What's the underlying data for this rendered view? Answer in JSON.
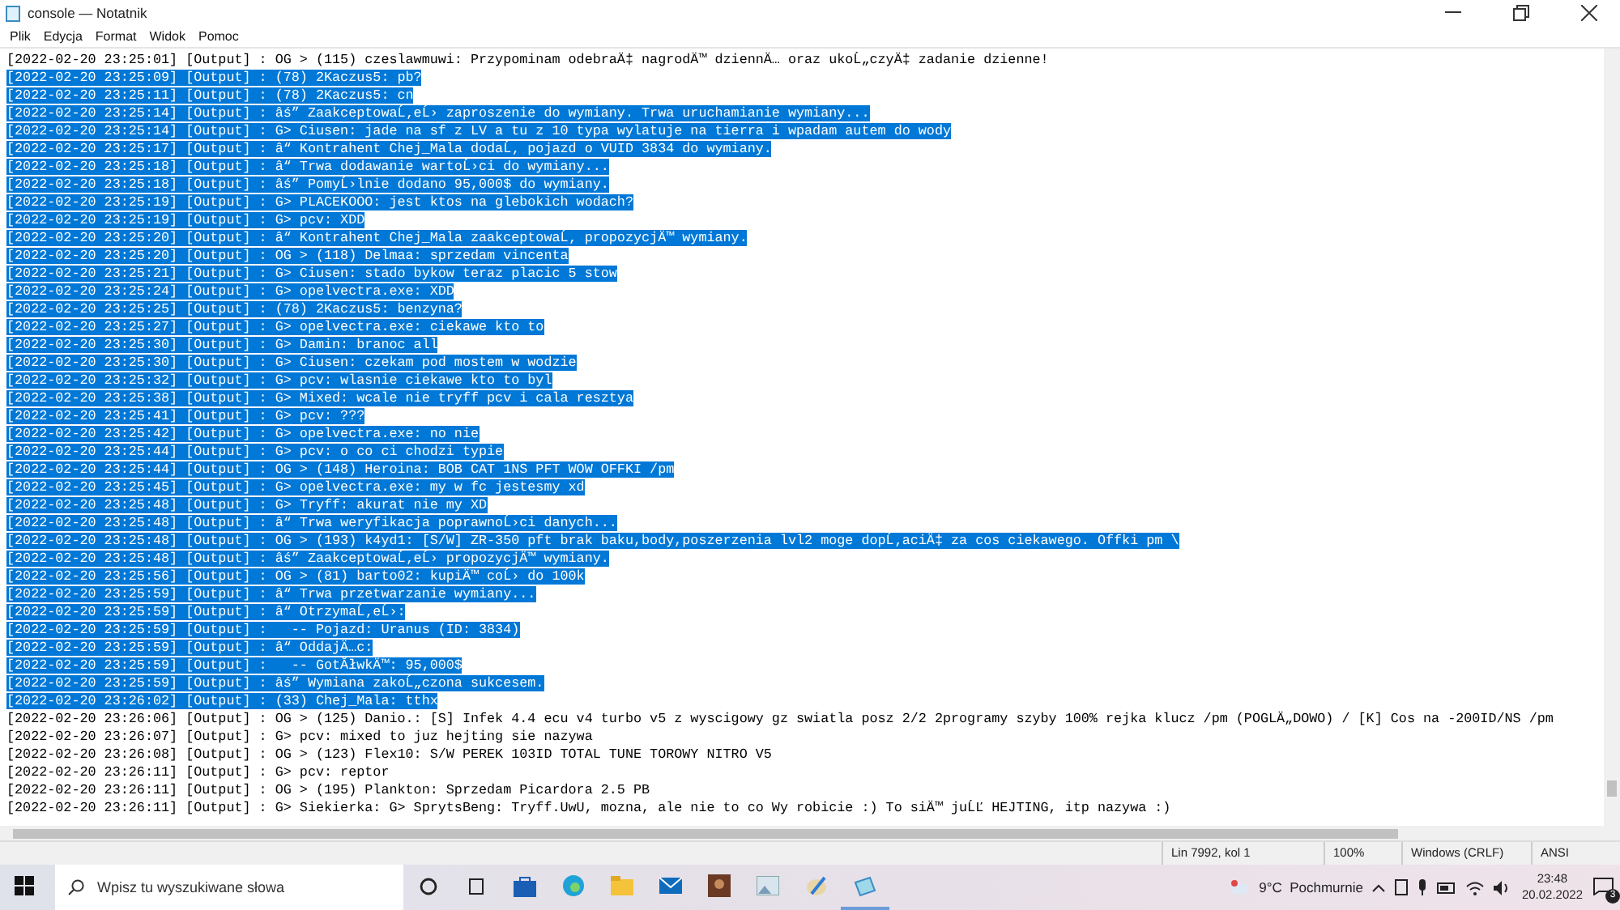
{
  "window": {
    "title": "console — Notatnik"
  },
  "menu": [
    "Plik",
    "Edycja",
    "Format",
    "Widok",
    "Pomoc"
  ],
  "lines": [
    {
      "text": "[2022-02-20 23:25:01] [Output] : OG > (115) czeslawmuwi: Przypominam odebraÄ‡ nagrodÄ™ dziennÄ… oraz ukoĹ„czyÄ‡ zadanie dzienne!",
      "selected": false
    },
    {
      "text": "[2022-02-20 23:25:09] [Output] : (78) 2Kaczus5: pb?",
      "selected": true
    },
    {
      "text": "[2022-02-20 23:25:11] [Output] : (78) 2Kaczus5: cn",
      "selected": true
    },
    {
      "text": "[2022-02-20 23:25:14] [Output] : âś” ZaakceptowaĹ‚eĹ› zaproszenie do wymiany. Trwa uruchamianie wymiany...",
      "selected": true
    },
    {
      "text": "[2022-02-20 23:25:14] [Output] : G> Ciusen: jade na sf z LV a tu z 10 typa wylatuje na tierra i wpadam autem do wody",
      "selected": true
    },
    {
      "text": "[2022-02-20 23:25:17] [Output] : â“ Kontrahent Chej_Mala dodaĹ‚ pojazd o VUID 3834 do wymiany.",
      "selected": true
    },
    {
      "text": "[2022-02-20 23:25:18] [Output] : â“ Trwa dodawanie wartoĹ›ci do wymiany...",
      "selected": true
    },
    {
      "text": "[2022-02-20 23:25:18] [Output] : âś” PomyĹ›lnie dodano 95,000$ do wymiany.",
      "selected": true
    },
    {
      "text": "[2022-02-20 23:25:19] [Output] : G> PLACEKOOO: jest ktos na glebokich wodach?",
      "selected": true
    },
    {
      "text": "[2022-02-20 23:25:19] [Output] : G> pcv: XDD",
      "selected": true
    },
    {
      "text": "[2022-02-20 23:25:20] [Output] : â“ Kontrahent Chej_Mala zaakceptowaĹ‚ propozycjÄ™ wymiany.",
      "selected": true
    },
    {
      "text": "[2022-02-20 23:25:20] [Output] : OG > (118) Delmaa: sprzedam vincenta",
      "selected": true
    },
    {
      "text": "[2022-02-20 23:25:21] [Output] : G> Ciusen: stado bykow teraz placic 5 stow",
      "selected": true
    },
    {
      "text": "[2022-02-20 23:25:24] [Output] : G> opelvectra.exe: XDD",
      "selected": true
    },
    {
      "text": "[2022-02-20 23:25:25] [Output] : (78) 2Kaczus5: benzyna?",
      "selected": true
    },
    {
      "text": "[2022-02-20 23:25:27] [Output] : G> opelvectra.exe: ciekawe kto to",
      "selected": true
    },
    {
      "text": "[2022-02-20 23:25:30] [Output] : G> Damin: branoc all",
      "selected": true
    },
    {
      "text": "[2022-02-20 23:25:30] [Output] : G> Ciusen: czekam pod mostem w wodzie",
      "selected": true
    },
    {
      "text": "[2022-02-20 23:25:32] [Output] : G> pcv: wlasnie ciekawe kto to byl",
      "selected": true
    },
    {
      "text": "[2022-02-20 23:25:38] [Output] : G> Mixed: wcale nie tryff pcv i cala resztya",
      "selected": true
    },
    {
      "text": "[2022-02-20 23:25:41] [Output] : G> pcv: ???",
      "selected": true
    },
    {
      "text": "[2022-02-20 23:25:42] [Output] : G> opelvectra.exe: no nie",
      "selected": true
    },
    {
      "text": "[2022-02-20 23:25:44] [Output] : G> pcv: o co ci chodzi typie",
      "selected": true
    },
    {
      "text": "[2022-02-20 23:25:44] [Output] : OG > (148) Heroina: BOB CAT 1NS PFT WOW OFFKI /pm",
      "selected": true
    },
    {
      "text": "[2022-02-20 23:25:45] [Output] : G> opelvectra.exe: my w fc jestesmy xd",
      "selected": true
    },
    {
      "text": "[2022-02-20 23:25:48] [Output] : G> Tryff: akurat nie my XD",
      "selected": true
    },
    {
      "text": "[2022-02-20 23:25:48] [Output] : â“ Trwa weryfikacja poprawnoĹ›ci danych...",
      "selected": true
    },
    {
      "text": "[2022-02-20 23:25:48] [Output] : OG > (193) k4yd1: [S/W] ZR-350 pft brak baku,body,poszerzenia lvl2 moge dopĹ‚aciÄ‡ za cos ciekawego. Offki pm \\",
      "selected": true
    },
    {
      "text": "[2022-02-20 23:25:48] [Output] : âś” ZaakceptowaĹ‚eĹ› propozycjÄ™ wymiany.",
      "selected": true
    },
    {
      "text": "[2022-02-20 23:25:56] [Output] : OG > (81) barto02: kupiÄ™ coĹ› do 100k",
      "selected": true
    },
    {
      "text": "[2022-02-20 23:25:59] [Output] : â“ Trwa przetwarzanie wymiany...",
      "selected": true
    },
    {
      "text": "[2022-02-20 23:25:59] [Output] : â“ OtrzymaĹ‚eĹ›:",
      "selected": true
    },
    {
      "text": "[2022-02-20 23:25:59] [Output] :   -- Pojazd: Uranus (ID: 3834)",
      "selected": true
    },
    {
      "text": "[2022-02-20 23:25:59] [Output] : â“ OddajÄ…c:",
      "selected": true
    },
    {
      "text": "[2022-02-20 23:25:59] [Output] :   -- GotĂłwkÄ™: 95,000$",
      "selected": true
    },
    {
      "text": "[2022-02-20 23:25:59] [Output] : âś” Wymiana zakoĹ„czona sukcesem.",
      "selected": true
    },
    {
      "text": "[2022-02-20 23:26:02] [Output] : (33) Chej_Mala: tthx",
      "selected": true
    },
    {
      "text": "[2022-02-20 23:26:06] [Output] : OG > (125) Danio.: [S] Infek 4.4 ecu v4 turbo v5 z wyscigowy gz swiatla posz 2/2 2programy szyby 100% rejka klucz /pm (POGLÄ„DOWO) / [K] Cos na -200ID/NS /pm",
      "selected": false
    },
    {
      "text": "[2022-02-20 23:26:07] [Output] : G> pcv: mixed to juz hejting sie nazywa",
      "selected": false
    },
    {
      "text": "[2022-02-20 23:26:08] [Output] : OG > (123) Flex10: S/W PEREK 103ID TOTAL TUNE TOROWY NITRO V5",
      "selected": false
    },
    {
      "text": "[2022-02-20 23:26:11] [Output] : G> pcv: reptor",
      "selected": false
    },
    {
      "text": "[2022-02-20 23:26:11] [Output] : OG > (195) Plankton: Sprzedam Picardora 2.5 PB",
      "selected": false
    },
    {
      "text": "[2022-02-20 23:26:11] [Output] : G> Siekierka: G> SprytsBeng: Tryff.UwU, mozna, ale nie to co Wy robicie :) To siÄ™ juĹĽ HEJTING, itp nazywa :)",
      "selected": false
    }
  ],
  "status_bar": [
    "Lin 7992, kol 1",
    "100%",
    "Windows (CRLF)",
    "ANSI"
  ],
  "taskbar": {
    "search": {
      "placeholder": "Wpisz tu wyszukiwane słowa"
    },
    "weather": "9°C  Pochmurnie",
    "time": "23:48",
    "date": "20.02.2022",
    "notifications": "3"
  }
}
